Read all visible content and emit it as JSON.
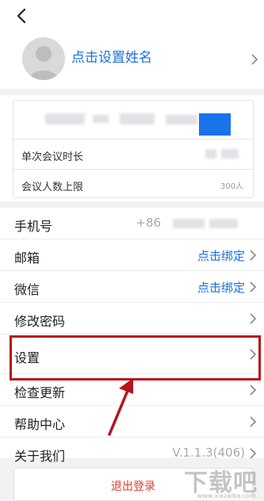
{
  "header": {
    "name_prompt": "点击设置姓名"
  },
  "meeting_card": {
    "rows": [
      {
        "label": "单次会议时长",
        "value": ""
      },
      {
        "label": "会议人数上限",
        "value": "300人"
      }
    ]
  },
  "settings": {
    "rows": [
      {
        "label": "手机号",
        "value": "+86"
      },
      {
        "label": "邮箱",
        "value": "点击绑定"
      },
      {
        "label": "微信",
        "value": "点击绑定"
      },
      {
        "label": "修改密码",
        "value": ""
      },
      {
        "label": "设置",
        "value": ""
      },
      {
        "label": "检查更新",
        "value": ""
      },
      {
        "label": "帮助中心",
        "value": ""
      },
      {
        "label": "关于我们",
        "value": "V.1.1.3(406)"
      }
    ]
  },
  "logout_label": "退出登录",
  "watermark": {
    "text": "下载吧",
    "url": "www.xiazaiba.com"
  },
  "colors": {
    "link": "#1e6fd9",
    "highlight": "#b5151b",
    "logout": "#e53935"
  }
}
